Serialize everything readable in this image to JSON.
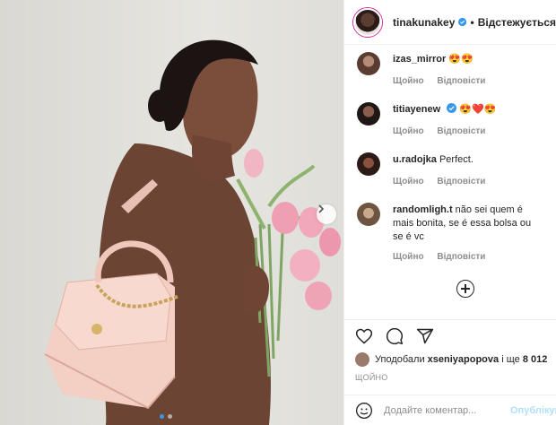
{
  "post": {
    "author": "tinakunakey",
    "separator": "•",
    "follow_state": "Відстежується",
    "photo_alt_icon": "photo"
  },
  "comments": [
    {
      "user": "izas_mirror",
      "text": "😍😍",
      "reply_time": "Щойно",
      "reply_label": "Відповісти",
      "avatar_color": "#7a5a4c"
    },
    {
      "user": "titiayenew",
      "text": "😍❤️😍",
      "reply_time": "Щойно",
      "reply_label": "Відповісти",
      "avatar_color": "#3b2a26",
      "verified": true
    },
    {
      "user": "u.radojka",
      "text": "Perfect.",
      "reply_time": "Щойно",
      "reply_label": "Відповісти",
      "avatar_color": "#4a2e2a"
    },
    {
      "user": "randomligh.t",
      "text": "não sei quem é mais bonita, se é essa bolsa ou se é vc",
      "reply_time": "Щойно",
      "reply_label": "Відповісти",
      "avatar_color": "#a88a70"
    }
  ],
  "likes": {
    "prefix": "Уподобали",
    "user": "xseniyapopova",
    "middle": "і ще",
    "count": "8 012"
  },
  "timestamp": "ЩОЙНО",
  "composer": {
    "placeholder": "Додайте коментар...",
    "publish": "Опублікувати"
  },
  "colors": {
    "verified": "#3897f0",
    "link_disabled": "#b2dffc",
    "muted": "#8e8e8e"
  }
}
